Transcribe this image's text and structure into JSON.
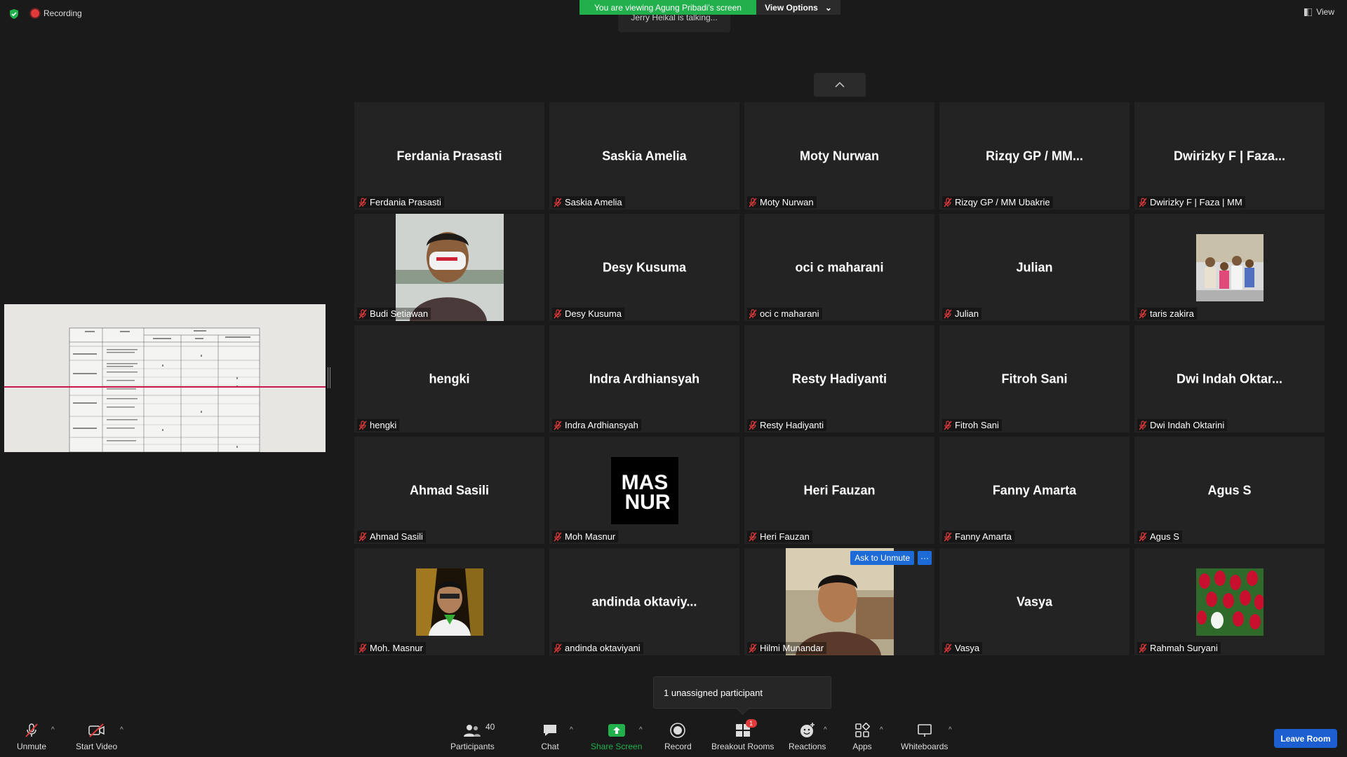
{
  "topbar": {
    "recording_label": "Recording",
    "viewing_banner": "You are viewing Agung Pribadi's screen",
    "view_options_label": "View Options",
    "talking_indicator": "Jerry Heikal is talking...",
    "view_label": "View"
  },
  "participants": [
    {
      "name": "Ferdania Prasasti",
      "label": "Ferdania Prasasti"
    },
    {
      "name": "Saskia Amelia",
      "label": "Saskia Amelia"
    },
    {
      "name": "Moty Nurwan",
      "label": "Moty Nurwan"
    },
    {
      "name": "Rizqy GP / MM...",
      "label": "Rizqy GP / MM Ubakrie"
    },
    {
      "name": "Dwirizky F | Faza...",
      "label": "Dwirizky F | Faza | MM"
    },
    {
      "name": "",
      "label": "Budi Setiawan",
      "photo": "man-with-mask"
    },
    {
      "name": "Desy Kusuma",
      "label": "Desy Kusuma"
    },
    {
      "name": "oci c maharani",
      "label": "oci c maharani"
    },
    {
      "name": "Julian",
      "label": "Julian"
    },
    {
      "name": "",
      "label": "taris zakira",
      "photo": "family-group"
    },
    {
      "name": "hengki",
      "label": "hengki"
    },
    {
      "name": "Indra Ardhiansyah",
      "label": "Indra Ardhiansyah"
    },
    {
      "name": "Resty Hadiyanti",
      "label": "Resty Hadiyanti"
    },
    {
      "name": "Fitroh Sani",
      "label": "Fitroh Sani"
    },
    {
      "name": "Dwi Indah Oktar...",
      "label": "Dwi Indah Oktarini"
    },
    {
      "name": "Ahmad Sasili",
      "label": "Ahmad Sasili"
    },
    {
      "name": "",
      "label": "Moh Masnur",
      "photo": "masnur-logo"
    },
    {
      "name": "Heri Fauzan",
      "label": "Heri Fauzan"
    },
    {
      "name": "Fanny Amarta",
      "label": "Fanny Amarta"
    },
    {
      "name": "Agus S",
      "label": "Agus S"
    },
    {
      "name": "",
      "label": "Moh. Masnur",
      "photo": "man-portrait"
    },
    {
      "name": "andinda  oktaviy...",
      "label": "andinda oktaviyani"
    },
    {
      "name": "",
      "label": "Hilmi Munandar",
      "photo": "man-selfie"
    },
    {
      "name": "Vasya",
      "label": "Vasya"
    },
    {
      "name": "",
      "label": "Rahmah Suryani",
      "photo": "red-tulips"
    }
  ],
  "tile_actions": {
    "ask_to_unmute": "Ask to Unmute",
    "more": "···"
  },
  "logo_text": {
    "line1": "MAS",
    "line2": "NUR"
  },
  "popup": {
    "unassigned": "1 unassigned participant"
  },
  "toolbar": {
    "unmute": "Unmute",
    "start_video": "Start Video",
    "participants": "Participants",
    "participants_count": "40",
    "chat": "Chat",
    "share_screen": "Share Screen",
    "record": "Record",
    "breakout_rooms": "Breakout Rooms",
    "breakout_badge": "1",
    "reactions": "Reactions",
    "apps": "Apps",
    "whiteboards": "Whiteboards",
    "leave_room": "Leave Room"
  },
  "colors": {
    "banner_green": "#21b04b",
    "leave_blue": "#1b5fd0",
    "mic_off_red": "#e03a3a",
    "share_green": "#21b04b"
  }
}
